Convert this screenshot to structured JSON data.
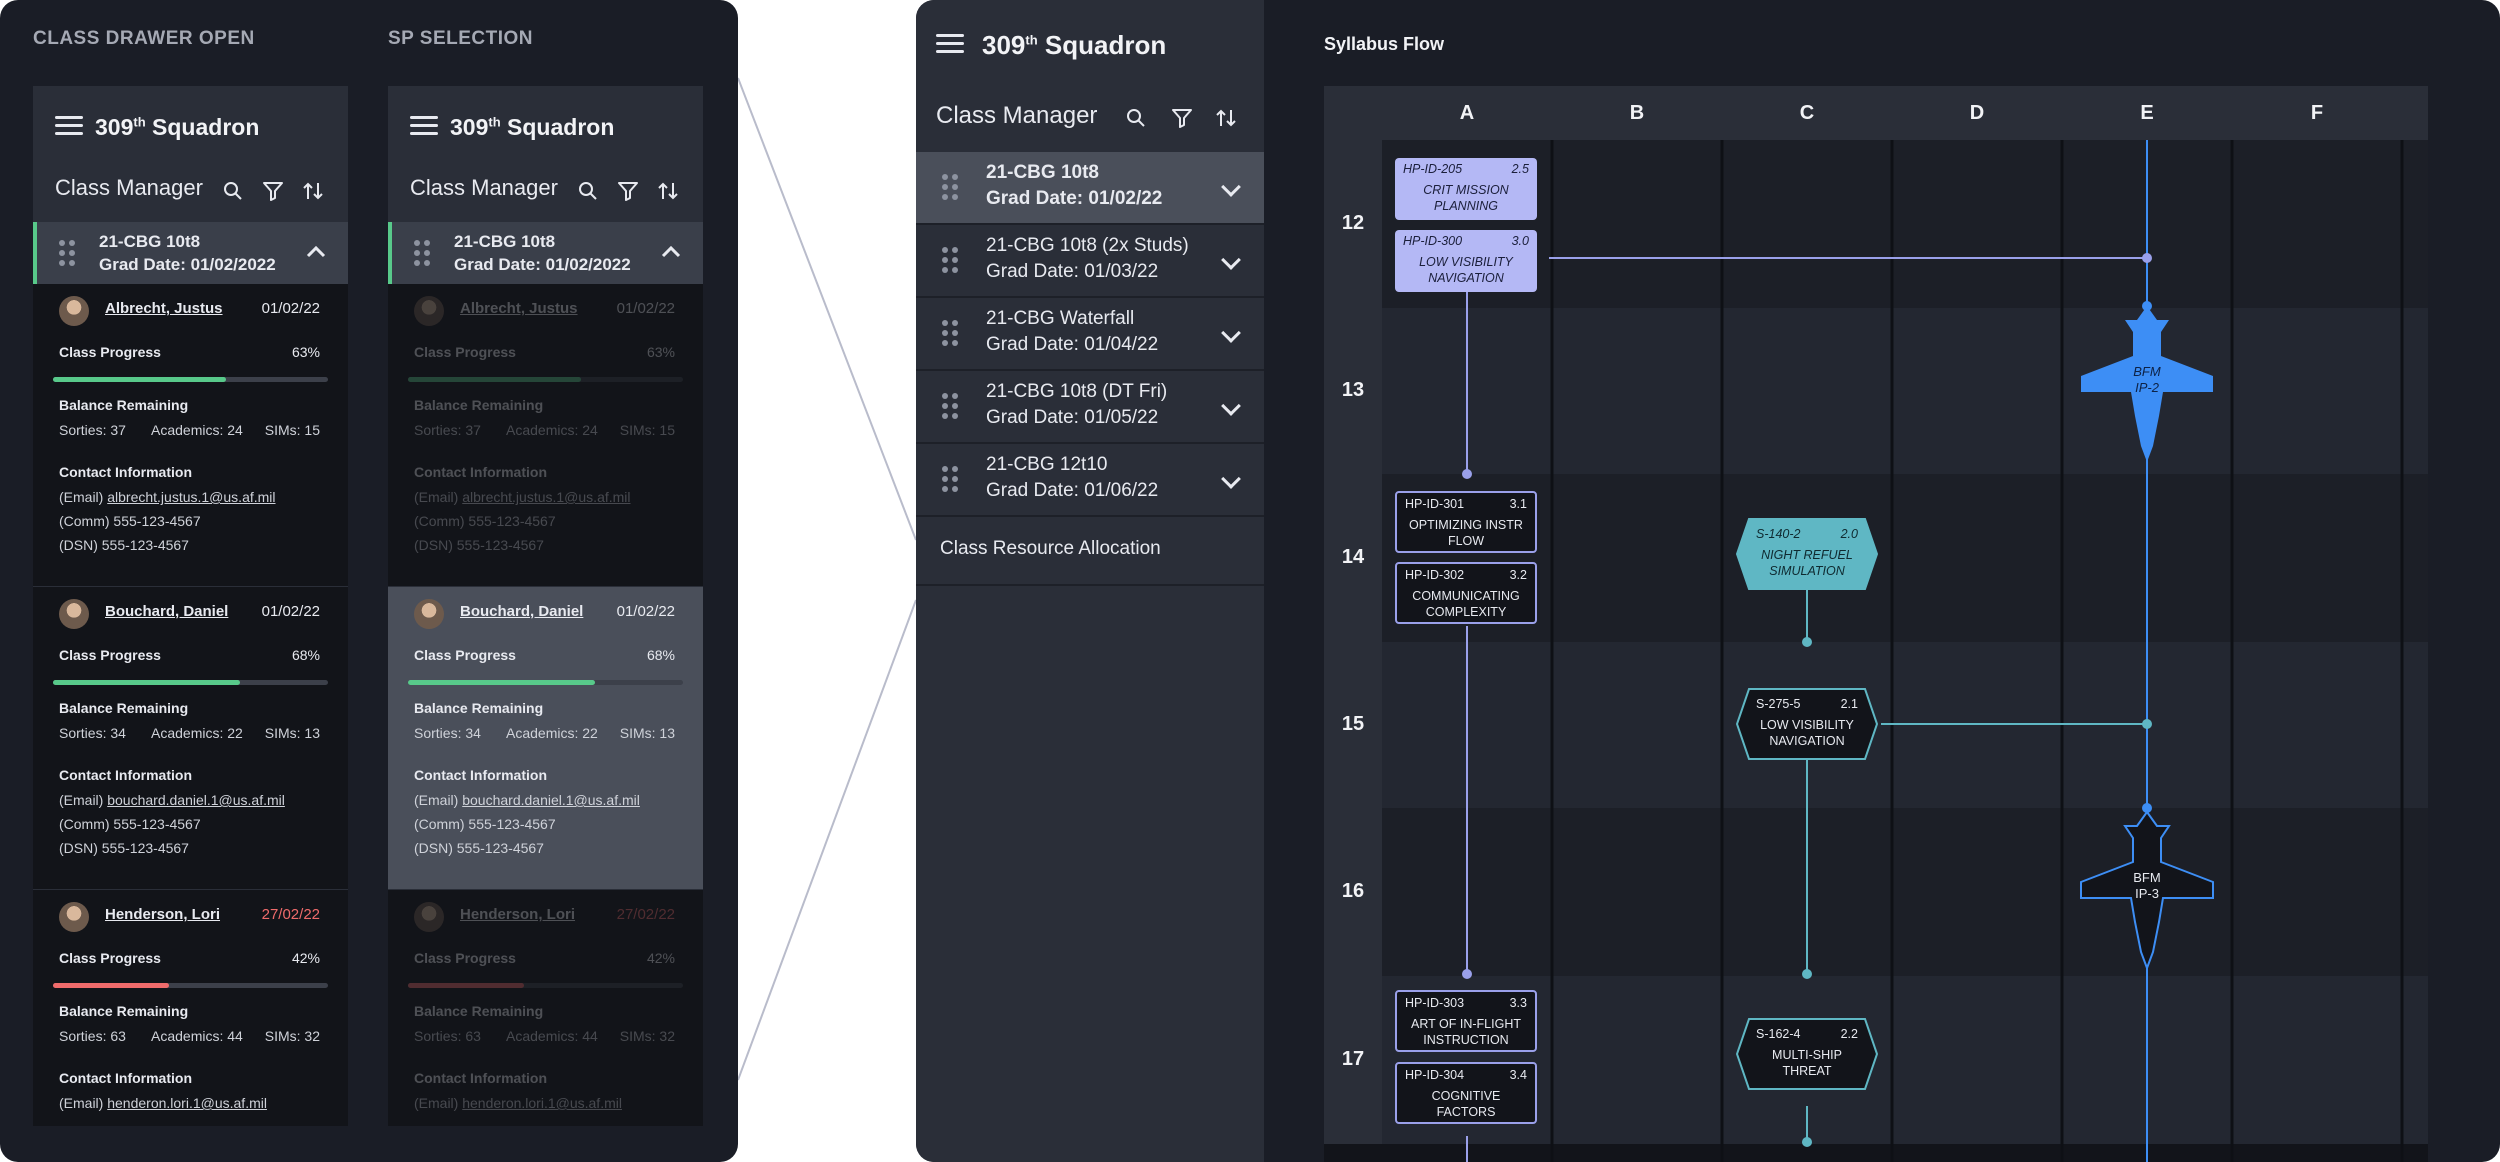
{
  "captions": {
    "left": "CLASS DRAWER OPEN",
    "right": "SP SELECTION"
  },
  "header": {
    "squadron": "309",
    "sup": "th",
    "squadron_suffix": "Squadron",
    "title": "Class Manager"
  },
  "selected_class": {
    "name": "21-CBG 10t8",
    "grad": "Grad Date: 01/02/2022"
  },
  "labels": {
    "progress": "Class Progress",
    "balance": "Balance Remaining",
    "contact": "Contact Information"
  },
  "students": [
    {
      "name": "Albrecht, Justus",
      "date": "01/02/22",
      "progress_text": "63%",
      "progress": 0.63,
      "bar_color": "#58c98a",
      "sorties": "Sorties: 37",
      "academics": "Academics: 24",
      "sims": "SIMs: 15",
      "email_prefix": "(Email) ",
      "email": "albrecht.justus.1@us.af.mil",
      "comm": "(Comm) 555-123-4567",
      "dsn": "(DSN) 555-123-4567"
    },
    {
      "name": "Bouchard, Daniel",
      "date": "01/02/22",
      "progress_text": "68%",
      "progress": 0.68,
      "bar_color": "#58c98a",
      "sorties": "Sorties: 34",
      "academics": "Academics: 22",
      "sims": "SIMs: 13",
      "email_prefix": "(Email) ",
      "email": "bouchard.daniel.1@us.af.mil",
      "comm": "(Comm) 555-123-4567",
      "dsn": "(DSN) 555-123-4567"
    },
    {
      "name": "Henderson, Lori",
      "date": "27/02/22",
      "date_color": "#ef6b6b",
      "progress_text": "42%",
      "progress": 0.42,
      "bar_color": "#ef6b6b",
      "sorties": "Sorties: 63",
      "academics": "Academics: 44",
      "sims": "SIMs: 32",
      "email_prefix": "(Email) ",
      "email": "henderon.lori.1@us.af.mil"
    }
  ],
  "sidebar": {
    "classes": [
      {
        "line1": "21-CBG 10t8",
        "line2": "Grad Date: 01/02/22",
        "selected": true
      },
      {
        "line1": "21-CBG 10t8 (2x Studs)",
        "line2": "Grad Date: 01/03/22"
      },
      {
        "line1": "21-CBG Waterfall",
        "line2": "Grad Date: 01/04/22"
      },
      {
        "line1": "21-CBG 10t8 (DT Fri)",
        "line2": "Grad Date: 01/05/22"
      },
      {
        "line1": "21-CBG 12t10",
        "line2": "Grad Date: 01/06/22"
      }
    ],
    "resource": "Class Resource Allocation"
  },
  "flow": {
    "title": "Syllabus Flow",
    "columns": [
      "A",
      "B",
      "C",
      "D",
      "E",
      "F"
    ],
    "rows": [
      "12",
      "13",
      "14",
      "15",
      "16",
      "17"
    ],
    "cards": [
      {
        "code": "HP-ID-205",
        "num": "2.5",
        "text": "CRIT MISSION PLANNING"
      },
      {
        "code": "HP-ID-300",
        "num": "3.0",
        "text": "LOW VISIBILITY NAVIGATION"
      },
      {
        "code": "HP-ID-301",
        "num": "3.1",
        "text": "OPTIMIZING INSTR FLOW"
      },
      {
        "code": "HP-ID-302",
        "num": "3.2",
        "text": "COMMUNICATING COMPLEXITY"
      },
      {
        "code": "HP-ID-303",
        "num": "3.3",
        "text": "ART OF IN-FLIGHT INSTRUCTION"
      },
      {
        "code": "HP-ID-304",
        "num": "3.4",
        "text": "COGNITIVE FACTORS"
      }
    ],
    "hexes": [
      {
        "code": "S-140-2",
        "num": "2.0",
        "text": "NIGHT REFUEL SIMULATION"
      },
      {
        "code": "S-275-5",
        "num": "2.1",
        "text": "LOW VISIBILITY NAVIGATION"
      },
      {
        "code": "S-162-4",
        "num": "2.2",
        "text": "MULTI-SHIP THREAT"
      }
    ],
    "jets": [
      {
        "label1": "BFM",
        "label2": "IP-2"
      },
      {
        "label1": "BFM",
        "label2": "IP-3"
      }
    ]
  },
  "colors": {
    "bg": "#1a1d26",
    "panel": "#2a2e38",
    "accent_green": "#58c98a",
    "accent_red": "#ef6b6b",
    "hp": "#b4b8f5",
    "sim": "#5fb7c4",
    "jet": "#3d8ef5"
  }
}
